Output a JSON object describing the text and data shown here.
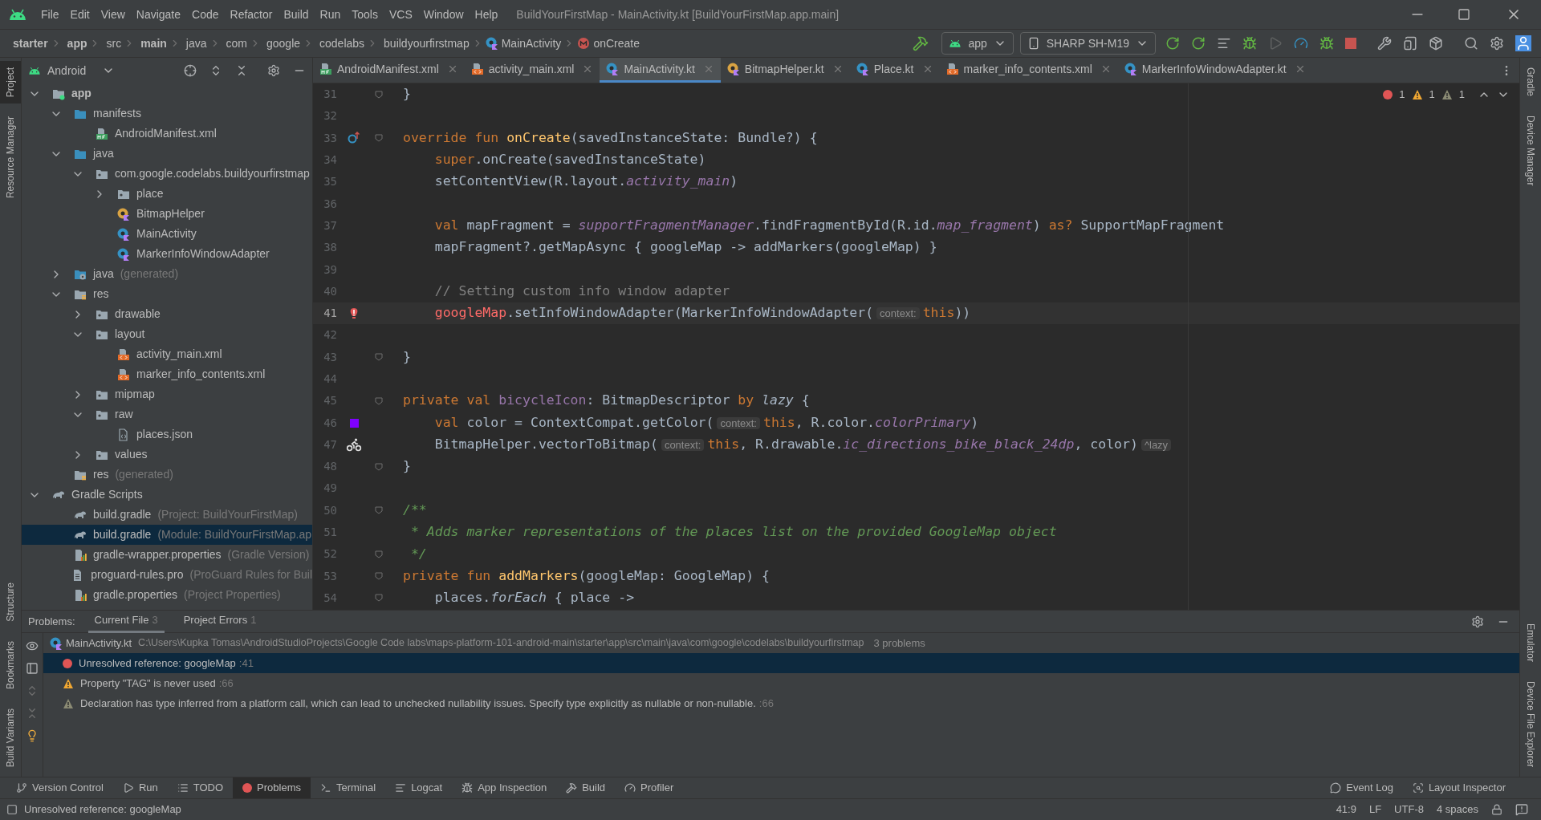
{
  "window": {
    "title": "BuildYourFirstMap - MainActivity.kt [BuildYourFirstMap.app.main]"
  },
  "menu": [
    "File",
    "Edit",
    "View",
    "Navigate",
    "Code",
    "Refactor",
    "Build",
    "Run",
    "Tools",
    "VCS",
    "Window",
    "Help"
  ],
  "breadcrumbs": [
    {
      "label": "starter",
      "bold": true
    },
    {
      "label": "app",
      "bold": true
    },
    {
      "label": "src",
      "bold": false
    },
    {
      "label": "main",
      "bold": true
    },
    {
      "label": "java",
      "bold": false
    },
    {
      "label": "com",
      "bold": false
    },
    {
      "label": "google",
      "bold": false
    },
    {
      "label": "codelabs",
      "bold": false
    },
    {
      "label": "buildyourfirstmap",
      "bold": false
    },
    {
      "label": "MainActivity",
      "bold": false,
      "kind": "class"
    },
    {
      "label": "onCreate",
      "bold": false,
      "kind": "method"
    }
  ],
  "run_config": "app",
  "device": "SHARP SH-M19",
  "left_stripe": {
    "top": [
      {
        "label": "Project",
        "selected": true
      },
      {
        "label": "Resource Manager",
        "selected": false
      }
    ],
    "bottom": [
      {
        "label": "Structure",
        "selected": false
      },
      {
        "label": "Bookmarks",
        "selected": false
      },
      {
        "label": "Build Variants",
        "selected": false
      }
    ]
  },
  "right_stripe": {
    "top": [
      {
        "label": "Gradle"
      },
      {
        "label": "Device Manager"
      }
    ],
    "bottom": [
      {
        "label": "Emulator"
      },
      {
        "label": "Device File Explorer"
      }
    ]
  },
  "project": {
    "view": "Android",
    "tree": [
      {
        "label": "app",
        "kind": "module",
        "bold": true,
        "expanded": true,
        "selected": false,
        "children": [
          {
            "label": "manifests",
            "kind": "folder",
            "expanded": true,
            "selected": false,
            "children": [
              {
                "label": "AndroidManifest.xml",
                "kind": "manifest",
                "selected": false
              }
            ]
          },
          {
            "label": "java",
            "kind": "folder",
            "expanded": true,
            "selected": false,
            "children": [
              {
                "label": "com.google.codelabs.buildyourfirstmap",
                "kind": "package",
                "expanded": true,
                "selected": false,
                "children": [
                  {
                    "label": "place",
                    "kind": "package",
                    "expanded": false,
                    "selected": false
                  },
                  {
                    "label": "BitmapHelper",
                    "kind": "object",
                    "selected": false
                  },
                  {
                    "label": "MainActivity",
                    "kind": "class",
                    "selected": false
                  },
                  {
                    "label": "MarkerInfoWindowAdapter",
                    "kind": "class",
                    "selected": false
                  }
                ]
              }
            ]
          },
          {
            "label": "java",
            "note": "(generated)",
            "kind": "generated",
            "expanded": false,
            "selected": false
          },
          {
            "label": "res",
            "kind": "resources",
            "expanded": true,
            "selected": false,
            "children": [
              {
                "label": "drawable",
                "kind": "package",
                "expanded": false,
                "selected": false
              },
              {
                "label": "layout",
                "kind": "package",
                "expanded": true,
                "selected": false,
                "children": [
                  {
                    "label": "activity_main.xml",
                    "kind": "layout",
                    "selected": false
                  },
                  {
                    "label": "marker_info_contents.xml",
                    "kind": "layout",
                    "selected": false
                  }
                ]
              },
              {
                "label": "mipmap",
                "kind": "package",
                "expanded": false,
                "selected": false
              },
              {
                "label": "raw",
                "kind": "package",
                "expanded": true,
                "selected": false,
                "children": [
                  {
                    "label": "places.json",
                    "kind": "data",
                    "selected": false
                  }
                ]
              },
              {
                "label": "values",
                "kind": "package",
                "expanded": false,
                "selected": false
              }
            ]
          },
          {
            "label": "res",
            "note": "(generated)",
            "kind": "resources",
            "selected": false
          }
        ]
      },
      {
        "label": "Gradle Scripts",
        "kind": "script",
        "expanded": true,
        "selected": false,
        "children": [
          {
            "label": "build.gradle",
            "note": "(Project: BuildYourFirstMap)",
            "kind": "script",
            "selected": false
          },
          {
            "label": "build.gradle",
            "note": "(Module: BuildYourFirstMap.ap",
            "kind": "script",
            "selected": true
          },
          {
            "label": "gradle-wrapper.properties",
            "note": "(Gradle Version)",
            "kind": "properties",
            "selected": false
          },
          {
            "label": "proguard-rules.pro",
            "note": "(ProGuard Rules for Buil",
            "kind": "text",
            "selected": false
          },
          {
            "label": "gradle.properties",
            "note": "(Project Properties)",
            "kind": "properties",
            "selected": false
          }
        ]
      }
    ]
  },
  "tabs": [
    {
      "label": "AndroidManifest.xml",
      "kind": "manifest",
      "selected": false
    },
    {
      "label": "activity_main.xml",
      "kind": "layout",
      "selected": false
    },
    {
      "label": "MainActivity.kt",
      "kind": "class",
      "selected": true
    },
    {
      "label": "BitmapHelper.kt",
      "kind": "object",
      "selected": false
    },
    {
      "label": "Place.kt",
      "kind": "class",
      "selected": false
    },
    {
      "label": "marker_info_contents.xml",
      "kind": "layout",
      "selected": false
    },
    {
      "label": "MarkerInfoWindowAdapter.kt",
      "kind": "class",
      "selected": false
    }
  ],
  "inspections": {
    "errors": "1",
    "warnings": "1",
    "weak_warnings": "1"
  },
  "code": [
    {
      "n": "31",
      "fold": true,
      "code": [
        {
          "t": "}",
          "kind": "plain"
        }
      ]
    },
    {
      "n": "32"
    },
    {
      "n": "33",
      "fold": true,
      "kind": "override",
      "code": [
        {
          "t": "override fun ",
          "kind": "keyword"
        },
        {
          "t": "onCreate",
          "kind": "function"
        },
        {
          "t": "(savedInstanceState: Bundle?) {",
          "kind": "plain"
        }
      ]
    },
    {
      "n": "34",
      "code": [
        {
          "t": "    super",
          "kind": "keyword"
        },
        {
          "t": ".onCreate(savedInstanceState)",
          "kind": "plain"
        }
      ]
    },
    {
      "n": "35",
      "code": [
        {
          "t": "    setContentView(R.layout.",
          "kind": "plain"
        },
        {
          "t": "activity_main",
          "kind": "field"
        },
        {
          "t": ")",
          "kind": "plain"
        }
      ]
    },
    {
      "n": "36"
    },
    {
      "n": "37",
      "code": [
        {
          "t": "    val",
          "kind": "keyword"
        },
        {
          "t": " mapFragment = ",
          "kind": "plain"
        },
        {
          "t": "supportFragmentManager",
          "kind": "field"
        },
        {
          "t": ".findFragmentById(R.id.",
          "kind": "plain"
        },
        {
          "t": "map_fragment",
          "kind": "field"
        },
        {
          "t": ") ",
          "kind": "plain"
        },
        {
          "t": "as?",
          "kind": "keyword"
        },
        {
          "t": " SupportMapFragment",
          "kind": "plain"
        }
      ]
    },
    {
      "n": "38",
      "code": [
        {
          "t": "    mapFragment?.getMapAsync { googleMap -> addMarkers(googleMap) }",
          "kind": "plain"
        }
      ]
    },
    {
      "n": "39"
    },
    {
      "n": "40",
      "code": [
        {
          "t": "    // Setting custom info window adapter",
          "kind": "comment"
        }
      ]
    },
    {
      "n": "41",
      "current": true,
      "kind": "error",
      "code": [
        {
          "t": "    googleMap",
          "kind": "error"
        },
        {
          "t": ".setInfoWindowAdapter(MarkerInfoWindowAdapter(",
          "kind": "plain"
        },
        {
          "t": "context:",
          "kind": "hint"
        },
        {
          "t": "this",
          "kind": "keyword"
        },
        {
          "t": "))",
          "kind": "plain"
        }
      ]
    },
    {
      "n": "42"
    },
    {
      "n": "43",
      "fold": true,
      "code": [
        {
          "t": "}",
          "kind": "plain"
        }
      ]
    },
    {
      "n": "44"
    },
    {
      "n": "45",
      "fold": true,
      "code": [
        {
          "t": "private val ",
          "kind": "keyword"
        },
        {
          "t": "bicycleIcon",
          "kind": "property"
        },
        {
          "t": ": BitmapDescriptor ",
          "kind": "plain"
        },
        {
          "t": "by ",
          "kind": "keyword"
        },
        {
          "t": "lazy",
          "kind": "italic"
        },
        {
          "t": " {",
          "kind": "plain"
        }
      ]
    },
    {
      "n": "46",
      "kind": "color",
      "color": "#7f00ff",
      "code": [
        {
          "t": "    val",
          "kind": "keyword"
        },
        {
          "t": " color = ContextCompat.getColor(",
          "kind": "plain"
        },
        {
          "t": "context:",
          "kind": "hint"
        },
        {
          "t": "this",
          "kind": "keyword"
        },
        {
          "t": ", R.color.",
          "kind": "plain"
        },
        {
          "t": "colorPrimary",
          "kind": "field"
        },
        {
          "t": ")",
          "kind": "plain"
        }
      ]
    },
    {
      "n": "47",
      "kind": "bike",
      "code": [
        {
          "t": "    BitmapHelper.vectorToBitmap(",
          "kind": "plain"
        },
        {
          "t": "context:",
          "kind": "hint"
        },
        {
          "t": "this",
          "kind": "keyword"
        },
        {
          "t": ", R.drawable.",
          "kind": "plain"
        },
        {
          "t": "ic_directions_bike_black_24dp",
          "kind": "field"
        },
        {
          "t": ", color)",
          "kind": "plain"
        },
        {
          "t": "^lazy",
          "kind": "hint"
        }
      ]
    },
    {
      "n": "48",
      "fold": true,
      "code": [
        {
          "t": "}",
          "kind": "plain"
        }
      ]
    },
    {
      "n": "49"
    },
    {
      "n": "50",
      "fold": true,
      "code": [
        {
          "t": "/**",
          "kind": "doc"
        }
      ]
    },
    {
      "n": "51",
      "code": [
        {
          "t": " * Adds marker representations of the places list on the provided GoogleMap object",
          "kind": "doc"
        }
      ]
    },
    {
      "n": "52",
      "fold": true,
      "code": [
        {
          "t": " */",
          "kind": "doc"
        }
      ]
    },
    {
      "n": "53",
      "fold": true,
      "code": [
        {
          "t": "private fun ",
          "kind": "keyword"
        },
        {
          "t": "addMarkers",
          "kind": "function"
        },
        {
          "t": "(googleMap: GoogleMap) {",
          "kind": "plain"
        }
      ]
    },
    {
      "n": "54",
      "fold": true,
      "code": [
        {
          "t": "    places.",
          "kind": "plain"
        },
        {
          "t": "forEach",
          "kind": "italic"
        },
        {
          "t": " { place ->",
          "kind": "plain"
        }
      ]
    }
  ],
  "problems": {
    "label": "Problems:",
    "tabs": [
      {
        "label": "Current File",
        "count": "3",
        "selected": true
      },
      {
        "label": "Project Errors",
        "count": "1",
        "selected": false
      }
    ],
    "file": {
      "name": "MainActivity.kt",
      "path": "C:\\Users\\Kupka Tomas\\AndroidStudioProjects\\Google Code labs\\maps-platform-101-android-main\\starter\\app\\src\\main\\java\\com\\google\\codelabs\\buildyourfirstmap",
      "count": "3 problems"
    },
    "items": [
      {
        "kind": "error",
        "message": "Unresolved reference: googleMap",
        "location": ":41",
        "selected": true
      },
      {
        "kind": "warning",
        "message": "Property \"TAG\" is never used",
        "location": ":66",
        "selected": false
      },
      {
        "kind": "weak",
        "message": "Declaration has type inferred from a platform call, which can lead to unchecked nullability issues. Specify type explicitly as nullable or non-nullable.",
        "location": ":66",
        "selected": false
      }
    ]
  },
  "tool_windows": [
    {
      "label": "Version Control",
      "kind": "vcs",
      "selected": false
    },
    {
      "label": "Run",
      "kind": "run",
      "selected": false
    },
    {
      "label": "TODO",
      "kind": "todo",
      "selected": false
    },
    {
      "label": "Problems",
      "kind": "problems",
      "selected": true
    },
    {
      "label": "Terminal",
      "kind": "terminal",
      "selected": false
    },
    {
      "label": "Logcat",
      "kind": "logcat",
      "selected": false
    },
    {
      "label": "App Inspection",
      "kind": "inspect",
      "selected": false
    },
    {
      "label": "Build",
      "kind": "build",
      "selected": false
    },
    {
      "label": "Profiler",
      "kind": "profiler",
      "selected": false
    }
  ],
  "tool_windows_right": [
    {
      "label": "Event Log",
      "kind": "event"
    },
    {
      "label": "Layout Inspector",
      "kind": "layout"
    }
  ],
  "status_bar": {
    "message": "Unresolved reference: googleMap",
    "position": "41:9",
    "line_ending": "LF",
    "encoding": "UTF-8",
    "indent": "4 spaces"
  }
}
